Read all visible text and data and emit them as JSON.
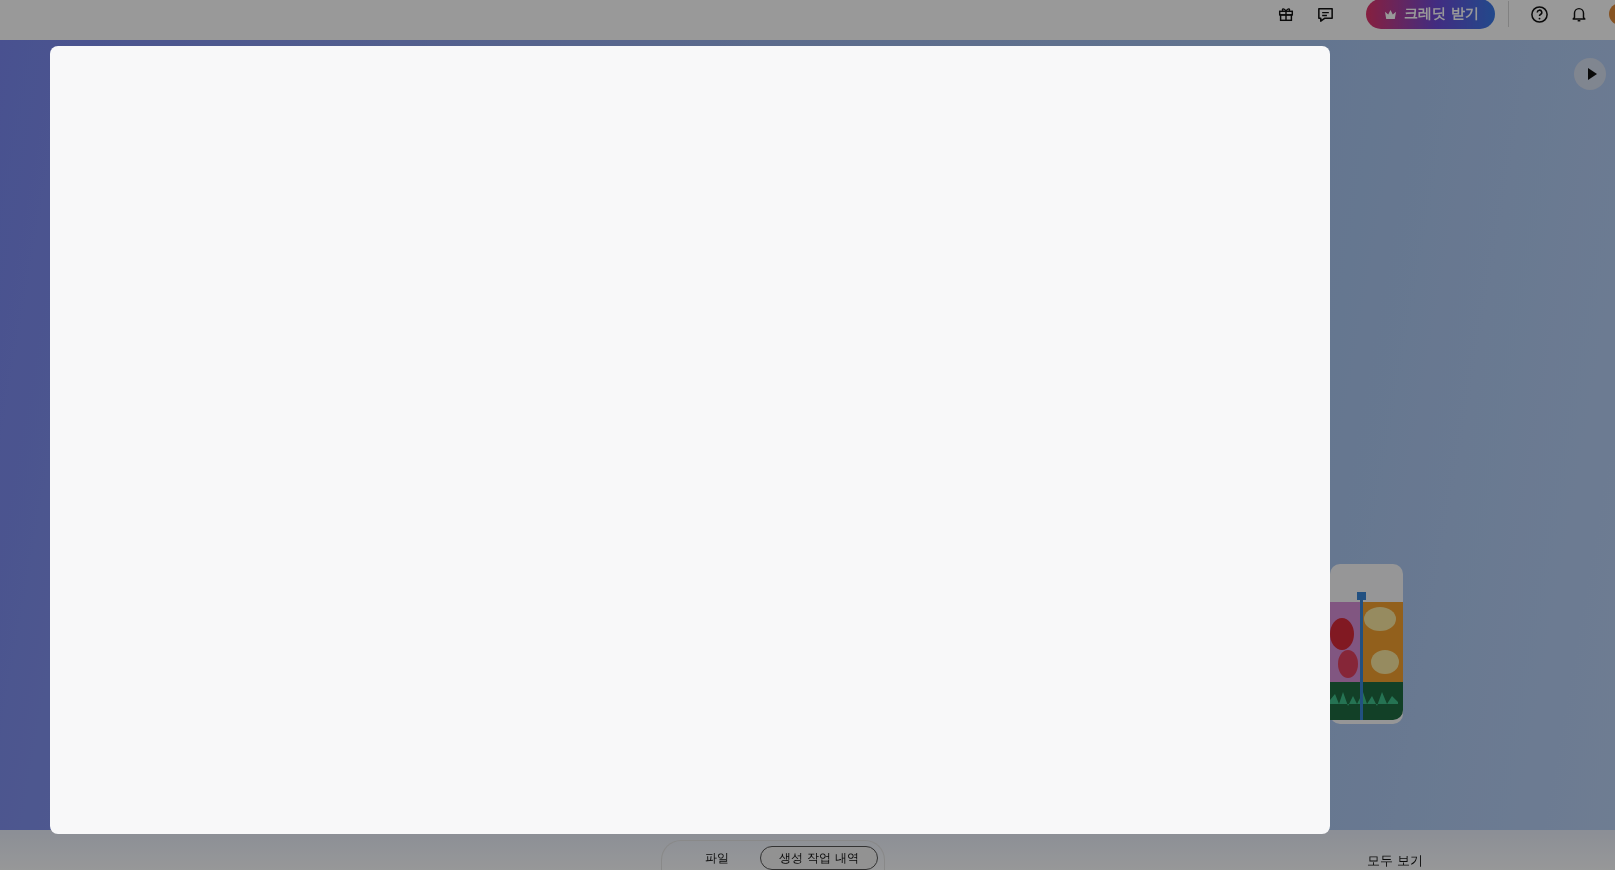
{
  "header": {
    "credit_button": {
      "label": "크레딧 받기"
    }
  },
  "bottom_tabs": [
    {
      "label": "파일",
      "selected": false
    },
    {
      "label": "생성 작업 내역",
      "selected": true
    }
  ],
  "see_all_link": {
    "label": "모두 보기"
  },
  "modal": {
    "open": true
  }
}
